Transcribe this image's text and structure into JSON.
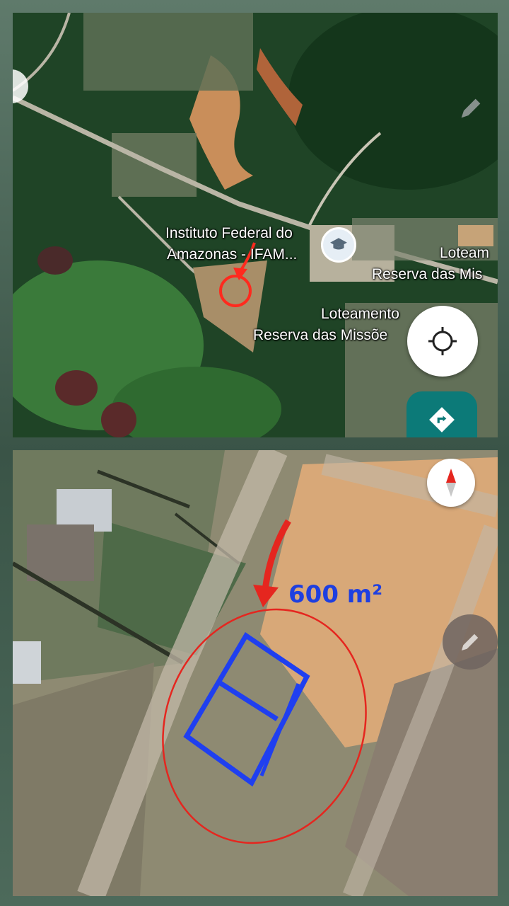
{
  "top_map": {
    "place_name_line1": "Instituto Federal do",
    "place_name_line2": "Amazonas - IFAM...",
    "lot_label_right_line1": "Loteam",
    "lot_label_right_line2": "Reserva das Mis",
    "lot_label_center_line1": "Loteamento",
    "lot_label_center_line2": "Reserva das Missõe",
    "icons": [
      "school-pin-icon",
      "crosshair-icon",
      "directions-icon",
      "pencil-icon"
    ]
  },
  "bottom_map": {
    "area_annotation": "600 m²",
    "annotation_colors": {
      "circle": "#e5261f",
      "parcel": "#1f3ff0",
      "arrow": "#e5261f"
    },
    "icons": [
      "compass-icon",
      "pencil-icon"
    ]
  }
}
